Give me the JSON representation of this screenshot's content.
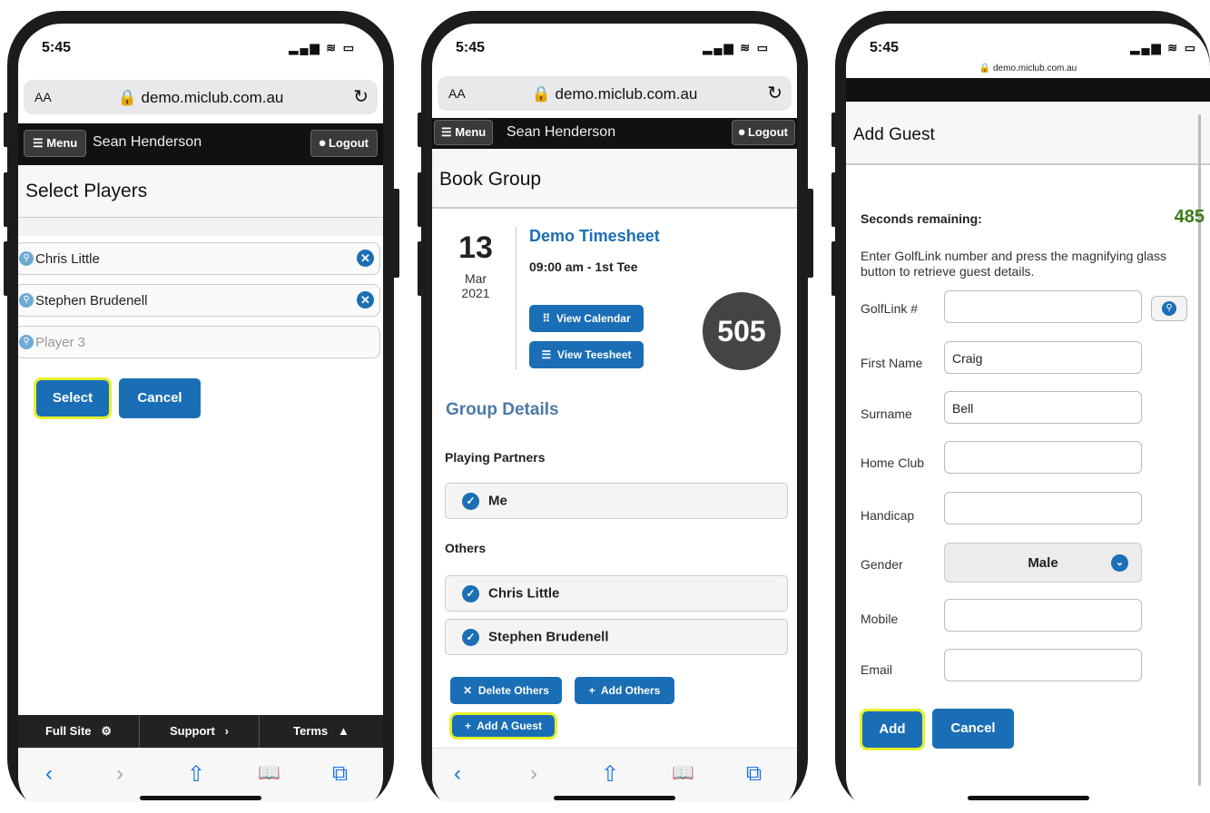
{
  "status": {
    "time": "5:45",
    "signal": "▂▄▆ ≋ ▭"
  },
  "browser": {
    "text_size": "AA",
    "host": "demo.miclub.com.au",
    "reload": "↻",
    "small_host": "demo.miclub.com.au"
  },
  "nav": {
    "menu": "☰ Menu",
    "user": "Sean Henderson",
    "logout": "Logout"
  },
  "screen1": {
    "title": "Select Players",
    "players": [
      "Chris Little",
      "Stephen Brudenell"
    ],
    "player3_placeholder": "Player 3",
    "select_label": "Select",
    "cancel_label": "Cancel",
    "footer": {
      "full_site": "Full Site",
      "support": "Support",
      "terms": "Terms"
    }
  },
  "screen2": {
    "title": "Book Group",
    "day": "13",
    "month": "Mar",
    "year": "2021",
    "timesheet": "Demo Timesheet",
    "time": "09:00 am - 1st Tee",
    "view_calendar": "View Calendar",
    "view_teesheet": "View Teesheet",
    "countdown": "505",
    "group_details": "Group Details",
    "playing_partners": "Playing Partners",
    "me": "Me",
    "others": "Others",
    "other_players": [
      "Chris Little",
      "Stephen Brudenell"
    ],
    "delete_others": "Delete Others",
    "add_others": "Add Others",
    "add_guest": "Add A Guest"
  },
  "screen3": {
    "title": "Add Guest",
    "seconds_label": "Seconds remaining:",
    "seconds_value": "485",
    "instructions": "Enter GolfLink number and press the magnifying glass button to retrieve guest details.",
    "fields": {
      "golflink": {
        "label": "GolfLink #",
        "value": ""
      },
      "first_name": {
        "label": "First Name",
        "value": "Craig"
      },
      "surname": {
        "label": "Surname",
        "value": "Bell"
      },
      "home_club": {
        "label": "Home Club",
        "value": ""
      },
      "handicap": {
        "label": "Handicap",
        "value": ""
      },
      "gender": {
        "label": "Gender",
        "value": "Male"
      },
      "mobile": {
        "label": "Mobile",
        "value": ""
      },
      "email": {
        "label": "Email",
        "value": ""
      }
    },
    "add_label": "Add",
    "cancel_label": "Cancel"
  },
  "toolbar": {
    "back": "‹",
    "forward": "›",
    "share": "⇧",
    "bookmarks": "📖",
    "tabs": "⧉"
  },
  "colors": {
    "accent": "#1a6eb5",
    "highlight": "#e6f02c",
    "countdown_green": "#3a7a1a"
  }
}
